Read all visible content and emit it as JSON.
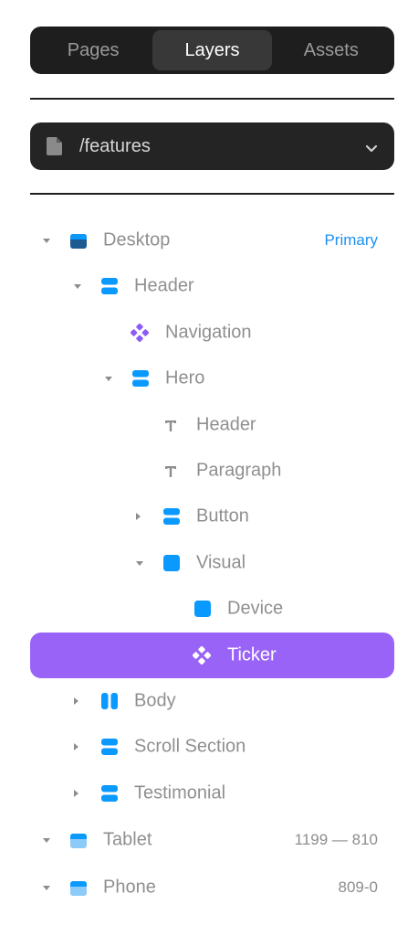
{
  "tabs": [
    {
      "label": "Pages",
      "active": false
    },
    {
      "label": "Layers",
      "active": true
    },
    {
      "label": "Assets",
      "active": false
    }
  ],
  "page_selector": {
    "path": "/features",
    "icon": "file-icon",
    "dropdown_icon": "chevron-down-icon"
  },
  "layers": [
    {
      "label": "Desktop",
      "indent": 0,
      "caret": "down",
      "icon": "frame-icon",
      "badge": "Primary"
    },
    {
      "label": "Header",
      "indent": 1,
      "caret": "down",
      "icon": "stack-icon"
    },
    {
      "label": "Navigation",
      "indent": 2,
      "caret": "",
      "icon": "component-icon"
    },
    {
      "label": "Hero",
      "indent": 2,
      "caret": "down",
      "icon": "stack-icon"
    },
    {
      "label": "Header",
      "indent": 3,
      "caret": "",
      "icon": "text-icon"
    },
    {
      "label": "Paragraph",
      "indent": 3,
      "caret": "",
      "icon": "text-icon"
    },
    {
      "label": "Button",
      "indent": 3,
      "caret": "right",
      "icon": "stack-icon"
    },
    {
      "label": "Visual",
      "indent": 3,
      "caret": "down",
      "icon": "frame-square-icon"
    },
    {
      "label": "Device",
      "indent": 4,
      "caret": "",
      "icon": "frame-square-icon"
    },
    {
      "label": "Ticker",
      "indent": 4,
      "caret": "",
      "icon": "component-icon",
      "selected": true
    },
    {
      "label": "Body",
      "indent": 1,
      "caret": "right",
      "icon": "columns-icon"
    },
    {
      "label": "Scroll Section",
      "indent": 1,
      "caret": "right",
      "icon": "stack-icon"
    },
    {
      "label": "Testimonial",
      "indent": 1,
      "caret": "right",
      "icon": "stack-icon"
    },
    {
      "label": "Tablet",
      "indent": 0,
      "caret": "down",
      "icon": "frame-light-icon",
      "meta": "1199 — 810"
    },
    {
      "label": "Phone",
      "indent": 0,
      "caret": "down",
      "icon": "frame-light-icon",
      "meta": "809-0"
    }
  ],
  "colors": {
    "accent_purple": "#9a63f7",
    "component_purple": "#8b5cf6",
    "layer_blue": "#0a99ff",
    "frame_dark": "#1c5a92",
    "frame_light": "#8ccaf7",
    "primary_badge": "#1e90ef"
  }
}
